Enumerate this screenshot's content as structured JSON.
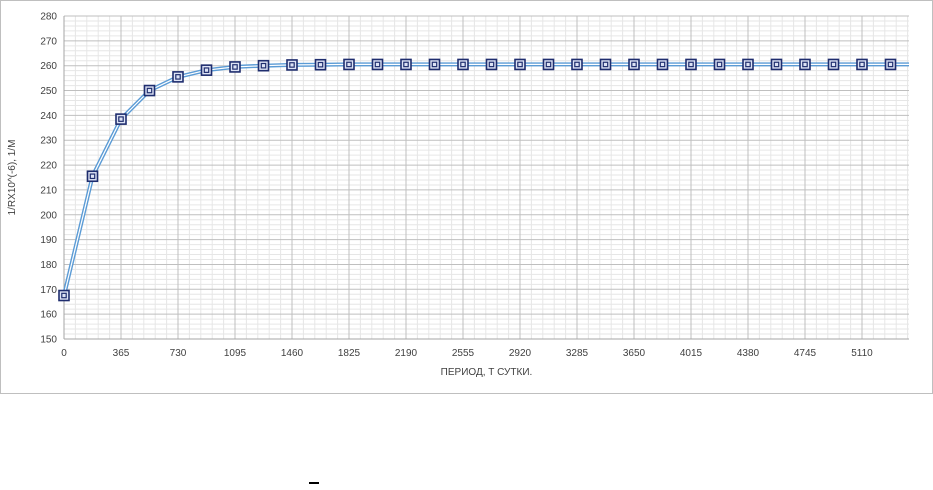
{
  "chart_data": {
    "type": "line",
    "title": "",
    "xlabel": "ПЕРИОД, Т СУТКИ.",
    "ylabel": "1/RX10^(-6), 1/M",
    "xlim": [
      0,
      5475
    ],
    "ylim": [
      150,
      280
    ],
    "y_major_ticks": [
      150,
      160,
      170,
      180,
      190,
      200,
      210,
      220,
      230,
      240,
      250,
      260,
      270,
      280
    ],
    "y_minor_step": 2,
    "x_tick_labels": [
      "0",
      "365",
      "730",
      "1095",
      "1460",
      "1825",
      "2190",
      "2555",
      "2920",
      "3285",
      "3650",
      "4015",
      "4380",
      "4745",
      "5110"
    ],
    "x_tick_values": [
      0,
      365,
      730,
      1095,
      1460,
      1825,
      2190,
      2555,
      2920,
      3285,
      3650,
      4015,
      4380,
      4745,
      5110
    ],
    "x_minor_step": 73,
    "grid": true,
    "marker": "square",
    "colors": {
      "line": "#5b9bd5",
      "line_highlight": "#ffffff",
      "marker_edge": "#1f2d6e",
      "marker_fill": "#dde3f5",
      "major_grid": "#bfbfbf",
      "minor_grid": "#e6e6e6",
      "axis": "#a6a6a6"
    },
    "series": [
      {
        "x": [
          0,
          182.5,
          365,
          547.5,
          730,
          912.5,
          1095,
          1277.5,
          1460,
          1642.5,
          1825,
          2007.5,
          2190,
          2372.5,
          2555,
          2737.5,
          2920,
          3102.5,
          3285,
          3467.5,
          3650,
          3832.5,
          4015,
          4197.5,
          4380,
          4562.5,
          4745,
          4927.5,
          5110,
          5292.5
        ],
        "y": [
          167.5,
          215.5,
          238.5,
          250,
          255.5,
          258.2,
          259.5,
          260,
          260.3,
          260.4,
          260.5,
          260.5,
          260.5,
          260.5,
          260.5,
          260.5,
          260.5,
          260.5,
          260.5,
          260.5,
          260.5,
          260.5,
          260.5,
          260.5,
          260.5,
          260.5,
          260.5,
          260.5,
          260.5,
          260.5
        ]
      }
    ]
  }
}
